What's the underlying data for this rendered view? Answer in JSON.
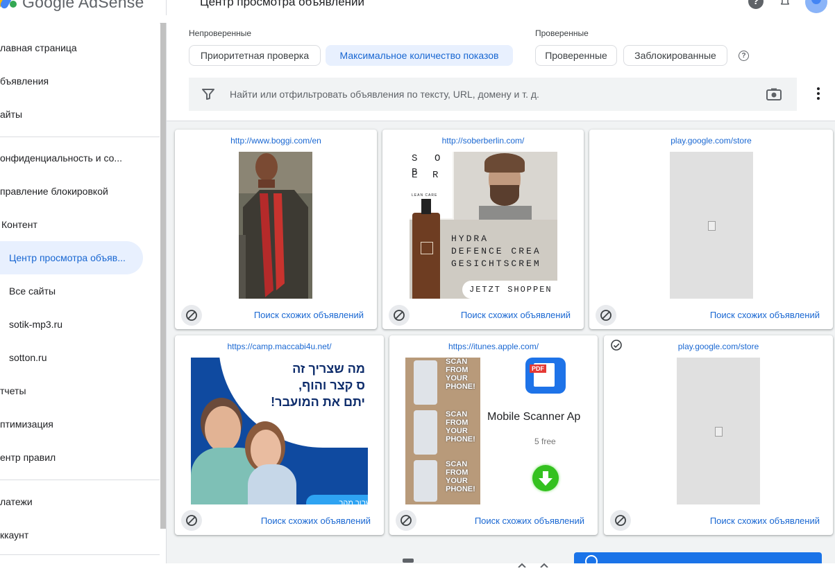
{
  "app": {
    "title": "Google AdSense",
    "logo_word": "Google",
    "logo_product": "AdSense",
    "page_title": "Центр просмотра объявлений"
  },
  "colors": {
    "accent": "#1967d2",
    "selected_bg": "#e8f0fe",
    "google_blue": "#4285f4",
    "google_red": "#ea4335",
    "google_yellow": "#fbbc04",
    "google_green": "#34a853"
  },
  "sidebar": {
    "items": [
      {
        "label": "лавная страница"
      },
      {
        "label": "бъявления"
      },
      {
        "label": "айты"
      },
      {
        "label": "онфиденциальность и со..."
      },
      {
        "label": "правление блокировкой"
      },
      {
        "label": "Контент"
      },
      {
        "label": "Центр просмотра объяв...",
        "selected": true
      },
      {
        "label": "Все сайты"
      },
      {
        "label": "sotik-mp3.ru"
      },
      {
        "label": "sotton.ru"
      },
      {
        "label": "тчеты"
      },
      {
        "label": "птимизация"
      },
      {
        "label": "ентр правил"
      },
      {
        "label": "латежи"
      },
      {
        "label": "ккаунт"
      }
    ]
  },
  "filters": {
    "unreviewed_label": "Непроверенные",
    "reviewed_label": "Проверенные",
    "chips": {
      "priority": "Приоритетная проверка",
      "max_impressions": "Максимальное количество показов",
      "reviewed": "Проверенные",
      "blocked": "Заблокированные"
    },
    "search_placeholder": "Найти или отфильтровать объявления по тексту, URL, домену и т. д."
  },
  "ads": [
    {
      "url": "http://www.boggi.com/en",
      "action": "Поиск схожих объявлений"
    },
    {
      "url": "http://soberberlin.com/",
      "action": "Поиск схожих объявлений",
      "creative": {
        "letters": [
          "S",
          "O",
          "B",
          "E",
          "R"
        ],
        "tagline": "LEAN CARE",
        "line1": "HYDRA",
        "line2": "DEFENCE CREA",
        "line3": "GESICHTSCREM",
        "cta": "JETZT SHOPPEN"
      }
    },
    {
      "url": "play.google.com/store",
      "action": "Поиск схожих объявлений"
    },
    {
      "url": "https://camp.maccabi4u.net/",
      "action": "Поиск схожих объявлений",
      "creative": {
        "line1": "מה שצריך זה",
        "line2": "ס קצר והוף,",
        "line3": "יתם את המועבר!",
        "cta": "לשבור מהר"
      }
    },
    {
      "url": "https://itunes.apple.com/",
      "action": "Поиск схожих объявлений",
      "creative": {
        "scan_text": [
          "SCAN",
          "FROM",
          "YOUR",
          "PHONE!"
        ],
        "pdf": "PDF",
        "title": "Mobile Scanner Ap",
        "subtitle": "5 free"
      }
    },
    {
      "url": "play.google.com/store",
      "action": "Поиск схожих объявлений"
    }
  ]
}
